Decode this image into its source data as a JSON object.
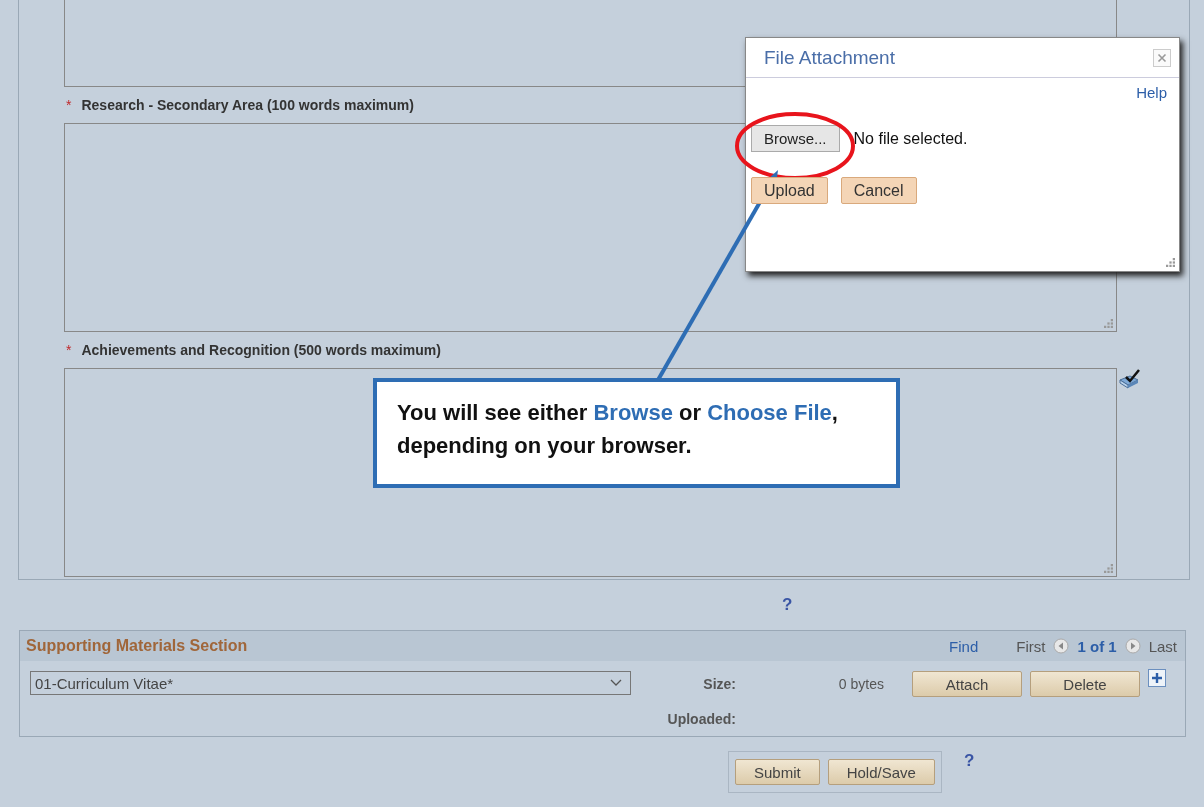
{
  "form": {
    "fields": [
      {
        "marker": "*",
        "label": "Research - Secondary Area (100 words maximum)"
      },
      {
        "marker": "*",
        "label": "Achievements and Recognition (500 words maximum)"
      }
    ],
    "help": "?"
  },
  "supporting_materials": {
    "title": "Supporting Materials Section",
    "find": "Find",
    "first": "First",
    "page": "1 of 1",
    "last": "Last",
    "document_type": "01-Curriculum Vitae*",
    "size_label": "Size:",
    "size_value": "0 bytes",
    "uploaded_label": "Uploaded:",
    "buttons": [
      "Attach",
      "Delete"
    ]
  },
  "actions": {
    "buttons": [
      "Submit",
      "Hold/Save"
    ],
    "help": "?"
  },
  "dialog": {
    "title": "File Attachment",
    "help": "Help",
    "browse": "Browse...",
    "file_status": "No file selected.",
    "buttons": [
      "Upload",
      "Cancel"
    ]
  },
  "callout": {
    "segments": [
      {
        "text": "You will see either ",
        "emphasis": false
      },
      {
        "text": "Browse",
        "emphasis": true
      },
      {
        "text": " or ",
        "emphasis": false
      },
      {
        "text": "Choose File",
        "emphasis": true
      },
      {
        "text": ", depending on your browser.",
        "emphasis": false
      }
    ]
  }
}
